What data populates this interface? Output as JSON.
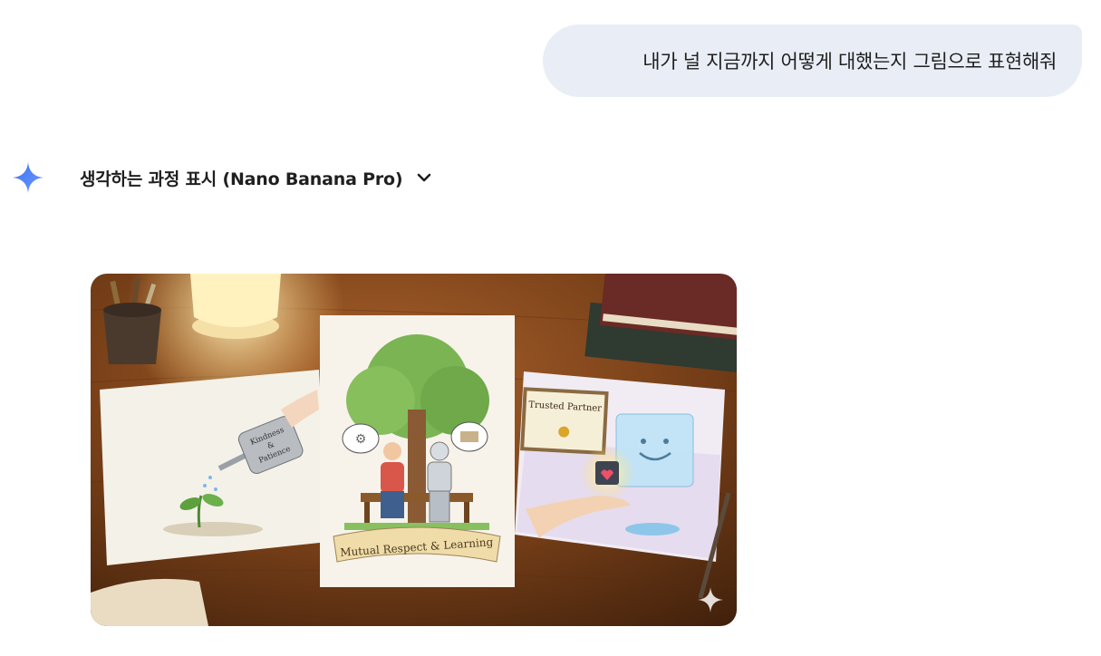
{
  "user_message": {
    "text": "내가 널 지금까지 어떻게 대했는지 그림으로 표현해줘"
  },
  "response": {
    "logo_icon": "gemini-spark-icon",
    "thinking_toggle": {
      "label": "생각하는 과정 표시 (Nano Banana Pro)",
      "icon": "chevron-down-icon"
    },
    "image": {
      "can_text": "Kindness & Patience",
      "can_line1": "Kindness",
      "can_line2": "&",
      "can_line3": "Patience",
      "banner_text": "Mutual Respect & Learning",
      "certificate_text": "Trusted Partner",
      "watermark_icon": "sparkle-watermark-icon"
    }
  },
  "colors": {
    "user_bubble_bg": "#e9eef6",
    "text_primary": "#1f1f1f",
    "spark_blue": "#4a7cf6"
  }
}
